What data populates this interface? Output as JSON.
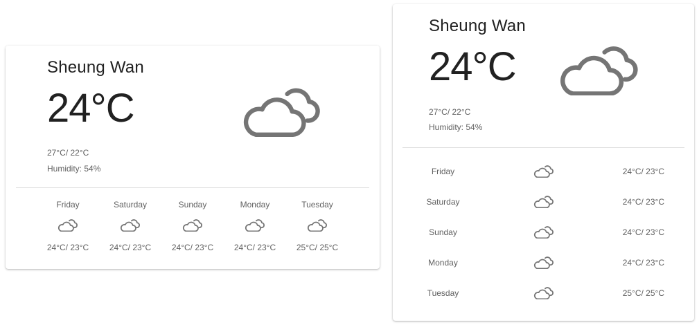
{
  "colors": {
    "icon": "#757575",
    "divider": "#e0e0e0",
    "text_primary": "#212121",
    "text_secondary": "#616161"
  },
  "icons": {
    "current": "cloudy-icon",
    "forecast": "cloudy-icon"
  },
  "horizontal_card": {
    "city": "Sheung Wan",
    "temperature": "24°C",
    "high_low": "27°C/ 22°C",
    "humidity": "Humidity: 54%",
    "forecast": [
      {
        "day": "Friday",
        "range": "24°C/ 23°C"
      },
      {
        "day": "Saturday",
        "range": "24°C/ 23°C"
      },
      {
        "day": "Sunday",
        "range": "24°C/ 23°C"
      },
      {
        "day": "Monday",
        "range": "24°C/ 23°C"
      },
      {
        "day": "Tuesday",
        "range": "25°C/ 25°C"
      }
    ]
  },
  "vertical_card": {
    "city": "Sheung Wan",
    "temperature": "24°C",
    "high_low": "27°C/ 22°C",
    "humidity": "Humidity: 54%",
    "forecast": [
      {
        "day": "Friday",
        "range": "24°C/ 23°C"
      },
      {
        "day": "Saturday",
        "range": "24°C/ 23°C"
      },
      {
        "day": "Sunday",
        "range": "24°C/ 23°C"
      },
      {
        "day": "Monday",
        "range": "24°C/ 23°C"
      },
      {
        "day": "Tuesday",
        "range": "25°C/ 25°C"
      }
    ]
  }
}
